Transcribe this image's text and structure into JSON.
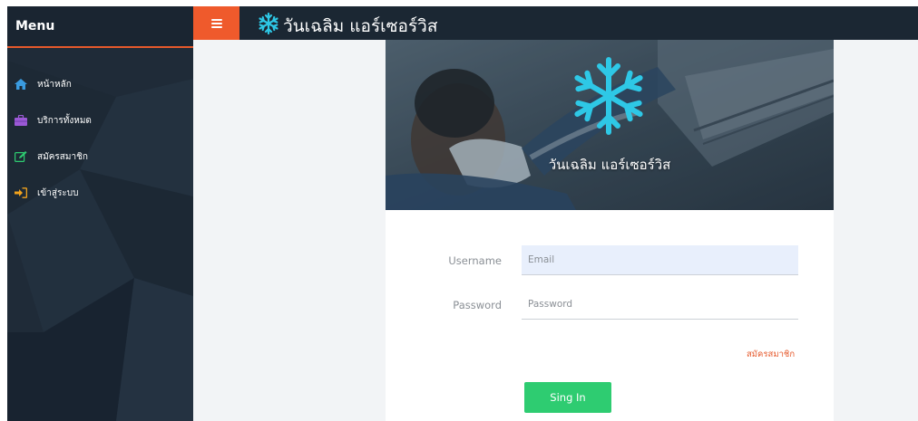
{
  "sidebar": {
    "title": "Menu",
    "items": [
      {
        "label": "หน้าหลัก",
        "icon": "home-icon",
        "icon_color": "#3a9be0"
      },
      {
        "label": "บริการทั้งหมด",
        "icon": "briefcase-icon",
        "icon_color": "#9b59d6"
      },
      {
        "label": "สมัครสมาชิก",
        "icon": "edit-icon",
        "icon_color": "#2ecc71"
      },
      {
        "label": "เข้าสู่ระบบ",
        "icon": "sign-in-icon",
        "icon_color": "#f1a21d"
      }
    ]
  },
  "header": {
    "brand": "วันเฉลิม แอร์เซอร์วิส",
    "menu_icon": "hamburger-icon"
  },
  "hero": {
    "title": "วันเฉลิม แอร์เซอร์วิส",
    "logo_icon": "snowflake-logo-icon"
  },
  "form": {
    "username_label": "Username",
    "username_placeholder": "Email",
    "password_label": "Password",
    "password_placeholder": "Password",
    "register_link": "สมัครสมาชิก",
    "submit_label": "Sing In"
  },
  "colors": {
    "accent": "#ef5a2c",
    "sidebar_bg": "#1f2b38",
    "topbar_bg": "#1b2733",
    "button_green": "#2ecc71",
    "link_orange": "#e65a2d",
    "logo_cyan": "#2ec8e6"
  }
}
